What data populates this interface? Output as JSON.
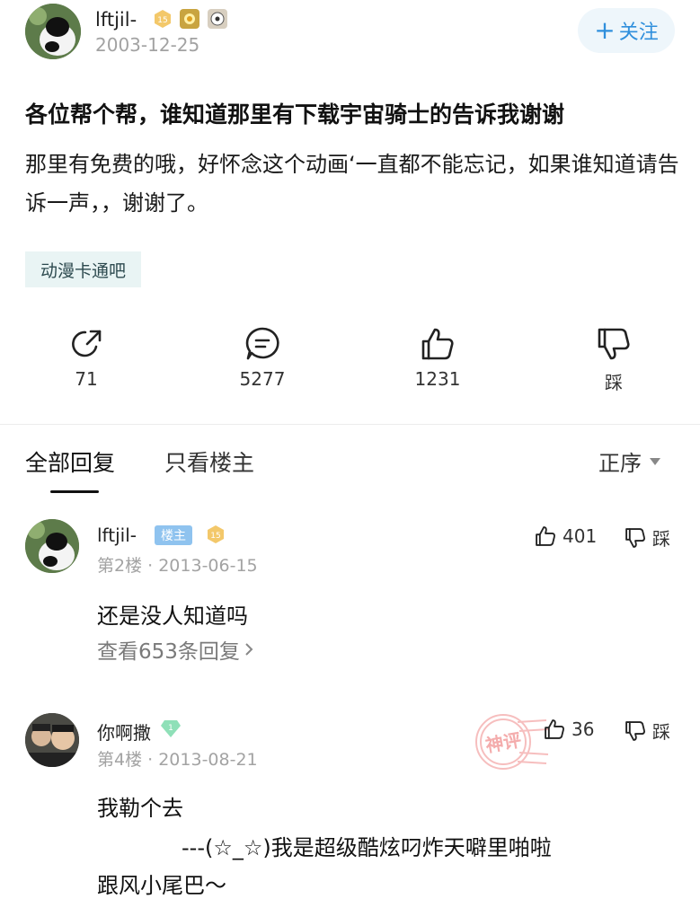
{
  "post": {
    "author": "lftjil-",
    "date": "2003-12-25",
    "follow_label": "关注",
    "title": "各位帮个帮，谁知道那里有下载宇宙骑士的告诉我谢谢",
    "body": "那里有免费的哦，好怀念这个动画‘一直都不能忘记，如果谁知道请告诉一声，，谢谢了。",
    "tag": "动漫卡通吧",
    "level_badge": "15"
  },
  "actions": {
    "share_count": "71",
    "comment_count": "5277",
    "like_count": "1231",
    "dislike_label": "踩"
  },
  "tabs": {
    "all_replies": "全部回复",
    "host_only": "只看楼主",
    "sort_label": "正序"
  },
  "replies": [
    {
      "name": "lftjil-",
      "host_badge": "楼主",
      "level_badge": "15",
      "floor": "第2楼",
      "date": "2013-06-15",
      "likes": "401",
      "dislike": "踩",
      "text": "还是没人知道吗",
      "view_more": "查看653条回复"
    },
    {
      "name": "你啊撒",
      "level_badge": "1",
      "floor": "第4楼",
      "date": "2013-08-21",
      "likes": "36",
      "dislike": "踩",
      "stamp": "神评",
      "text_line1": "我勒个去",
      "text_line2": "---(☆_☆)我是超级酷炫叼炸天噼里啪啦",
      "text_line3": "跟风小尾巴～"
    }
  ],
  "colors": {
    "accent": "#2f8fdc",
    "tag_bg": "#e9f4f4",
    "stamp": "#f08a8a"
  }
}
